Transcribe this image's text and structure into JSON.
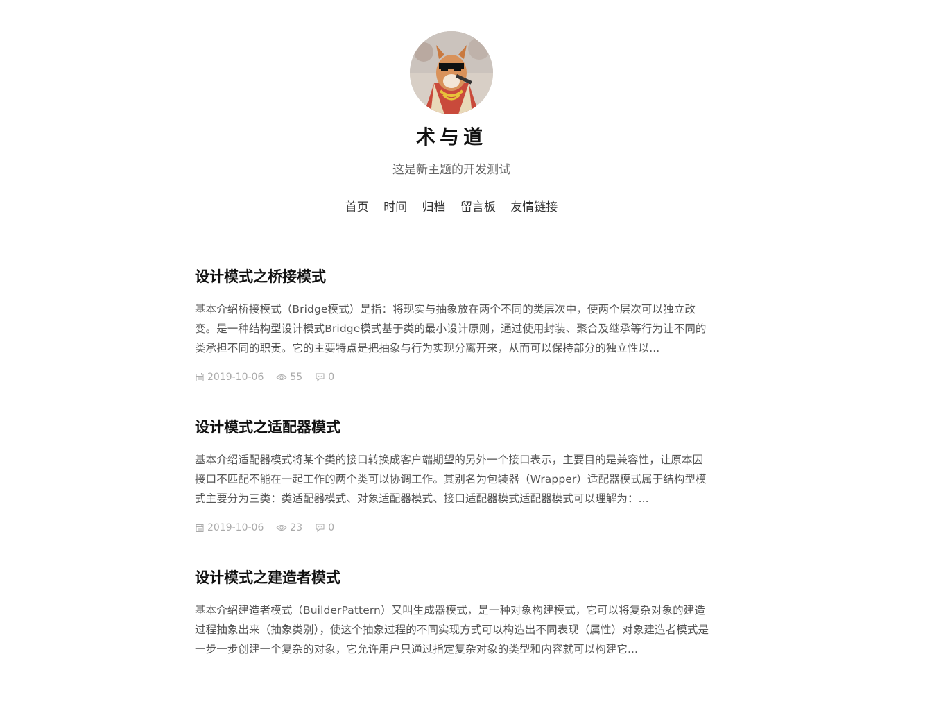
{
  "site": {
    "title": "术与道",
    "subtitle": "这是新主题的开发测试"
  },
  "nav": {
    "items": [
      {
        "label": "首页"
      },
      {
        "label": "时间"
      },
      {
        "label": "归档"
      },
      {
        "label": "留言板"
      },
      {
        "label": "友情链接"
      }
    ]
  },
  "posts": [
    {
      "title": "设计模式之桥接模式",
      "excerpt": "基本介绍桥接模式（Bridge模式）是指：将现实与抽象放在两个不同的类层次中，使两个层次可以独立改变。是一种结构型设计模式Bridge模式基于类的最小设计原则，通过使用封装、聚合及继承等行为让不同的类承担不同的职责。它的主要特点是把抽象与行为实现分离开来，从而可以保持部分的独立性以...",
      "date": "2019-10-06",
      "views": "55",
      "comments": "0"
    },
    {
      "title": "设计模式之适配器模式",
      "excerpt": "基本介绍适配器模式将某个类的接口转换成客户端期望的另外一个接口表示，主要目的是兼容性，让原本因接口不匹配不能在一起工作的两个类可以协调工作。其别名为包装器（Wrapper）适配器模式属于结构型模式主要分为三类：类适配器模式、对象适配器模式、接口适配器模式适配器模式可以理解为：...",
      "date": "2019-10-06",
      "views": "23",
      "comments": "0"
    },
    {
      "title": "设计模式之建造者模式",
      "excerpt": "基本介绍建造者模式（BuilderPattern）又叫生成器模式，是一种对象构建模式，它可以将复杂对象的建造过程抽象出来（抽象类别），使这个抽象过程的不同实现方式可以构造出不同表现（属性）对象建造者模式是一步一步创建一个复杂的对象，它允许用户只通过指定复杂对象的类型和内容就可以构建它...",
      "date": "",
      "views": "",
      "comments": ""
    }
  ],
  "icons": {
    "date": "calendar-icon",
    "views": "eye-icon",
    "comments": "comment-icon"
  },
  "colors": {
    "text": "#333333",
    "meta": "#aaaaaa",
    "background": "#ffffff"
  }
}
